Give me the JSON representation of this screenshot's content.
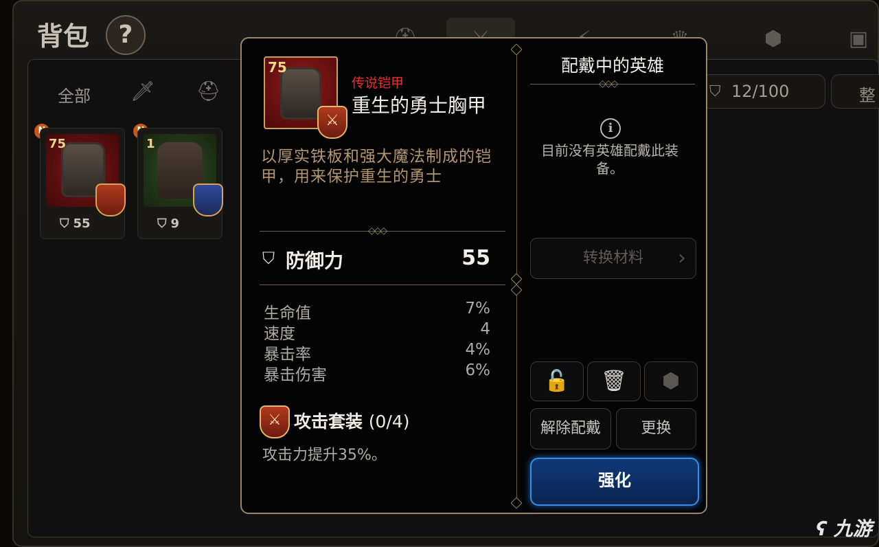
{
  "background": {
    "title": "背包",
    "help_label": "?",
    "filter_all": "全部",
    "capacity": "12/100",
    "sort_label": "整",
    "cards": [
      {
        "level": "75",
        "defense": "55",
        "new_badge": "N"
      },
      {
        "level": "1",
        "defense": "9",
        "new_badge": "N"
      }
    ]
  },
  "item": {
    "level": "75",
    "rarity": "传说铠甲",
    "name": "重生的勇士胸甲",
    "description": "以厚实铁板和强大魔法制成的铠甲，用来保护重生的勇士",
    "main_stat": {
      "label": "防御力",
      "value": "55"
    },
    "sub_stats": [
      {
        "label": "生命值",
        "value": "7%"
      },
      {
        "label": "速度",
        "value": "4"
      },
      {
        "label": "暴击率",
        "value": "4%"
      },
      {
        "label": "暴击伤害",
        "value": "6%"
      }
    ],
    "set": {
      "name": "攻击套装",
      "count": "(0/4)",
      "effect": "攻击力提升35%。"
    }
  },
  "hero_panel": {
    "title": "配戴中的英雄",
    "message": "目前没有英雄配戴此装备。",
    "convert_label": "转换材料",
    "unequip_label": "解除配戴",
    "replace_label": "更换",
    "enhance_label": "强化"
  },
  "watermark": "九游",
  "colors": {
    "rarity": "#ec2b2b",
    "accent_border": "#9b8667",
    "enhance": "#0f3a7a",
    "description": "#b4956e"
  }
}
